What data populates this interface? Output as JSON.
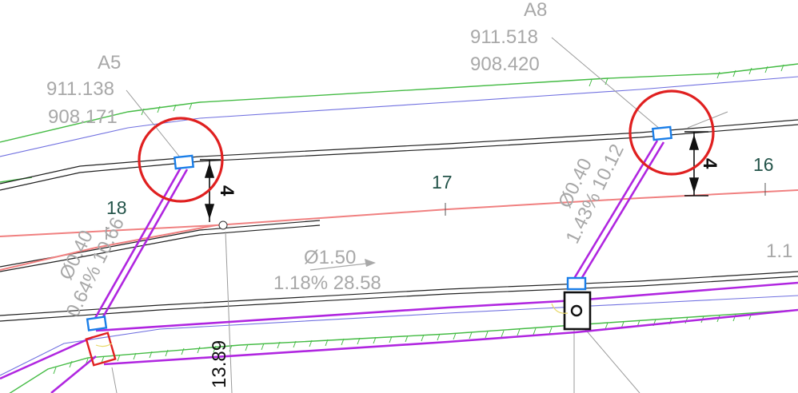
{
  "structures": [
    {
      "id": "A5",
      "rim": "911.138",
      "invert": "908.171"
    },
    {
      "id": "A8",
      "rim": "911.518",
      "invert": "908.420"
    }
  ],
  "pipe_labels": [
    {
      "diameter": "Ø0.40",
      "slope_length": "0.64% 10.66"
    },
    {
      "diameter": "Ø0.40",
      "slope_length": "1.43% 10.12"
    },
    {
      "diameter": "Ø1.50",
      "slope_length": "1.18% 28.58"
    }
  ],
  "station_labels": [
    "18",
    "17",
    "16"
  ],
  "dimension_labels": [
    "4",
    "4"
  ],
  "vertical_label": "13.89",
  "edge_label": "1.1",
  "colors": {
    "pipe": "#b026e0",
    "highlight": "#e02020",
    "alignment": "#f08080",
    "inlet": "#1a7ee8",
    "grading": "#44bb44",
    "edge": "#7070e0"
  }
}
